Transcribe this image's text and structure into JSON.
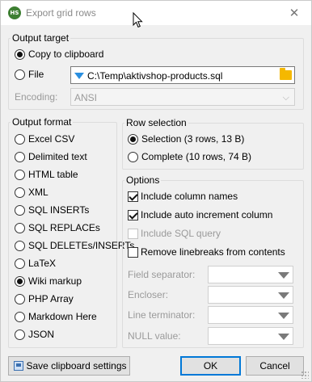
{
  "window": {
    "title": "Export grid rows",
    "app_icon": "HS",
    "close": "✕"
  },
  "output_target": {
    "legend": "Output target",
    "copy_label": "Copy to clipboard",
    "file_label": "File",
    "file_value": "C:\\Temp\\aktivshop-products.sql",
    "encoding_label": "Encoding:",
    "encoding_value": "ANSI",
    "selected": "copy"
  },
  "output_format": {
    "legend": "Output format",
    "items": [
      {
        "label": "Excel CSV",
        "selected": false
      },
      {
        "label": "Delimited text",
        "selected": false
      },
      {
        "label": "HTML table",
        "selected": false
      },
      {
        "label": "XML",
        "selected": false
      },
      {
        "label": "SQL INSERTs",
        "selected": false
      },
      {
        "label": "SQL REPLACEs",
        "selected": false
      },
      {
        "label": "SQL DELETEs/INSERTs",
        "selected": false
      },
      {
        "label": "LaTeX",
        "selected": false
      },
      {
        "label": "Wiki markup",
        "selected": true
      },
      {
        "label": "PHP Array",
        "selected": false
      },
      {
        "label": "Markdown Here",
        "selected": false
      },
      {
        "label": "JSON",
        "selected": false
      }
    ]
  },
  "row_selection": {
    "legend": "Row selection",
    "selection_label": "Selection (3 rows, 13 B)",
    "complete_label": "Complete (10 rows, 74 B)",
    "selected": "selection"
  },
  "options": {
    "legend": "Options",
    "include_column_names": "Include column names",
    "include_auto_increment": "Include auto increment column",
    "include_sql_query": "Include SQL query",
    "remove_linebreaks": "Remove linebreaks from contents",
    "field_separator": "Field separator:",
    "encloser": "Encloser:",
    "line_terminator": "Line terminator:",
    "null_value": "NULL value:"
  },
  "buttons": {
    "save_clipboard": "Save clipboard settings",
    "ok": "OK",
    "cancel": "Cancel"
  },
  "colors": {
    "accent": "#0078d7",
    "file_arrow": "#2a8fe0",
    "folder": "#f5b800",
    "app_icon": "#3d7f32"
  }
}
